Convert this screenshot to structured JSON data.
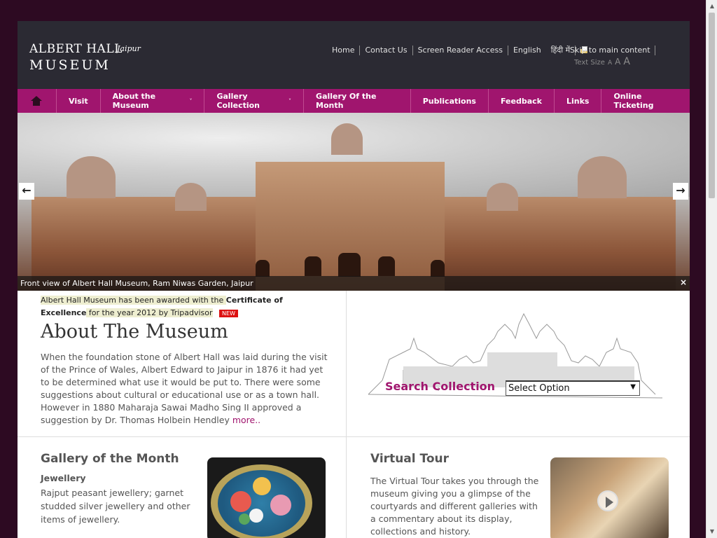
{
  "header": {
    "logo_line1": "ALBERT HALL",
    "logo_jaipur": "Jaipur",
    "logo_line2": "MUSEUM",
    "top_links": [
      "Home",
      "Contact Us",
      "Screen Reader Access",
      "English",
      "हिंदी में"
    ],
    "skip_link": "Skip to main content",
    "text_size_label": "Text Size",
    "text_size_options": [
      "A",
      "A",
      "A"
    ]
  },
  "nav": {
    "items": [
      {
        "label": "Visit"
      },
      {
        "label": "About the Museum",
        "has_dropdown": true
      },
      {
        "label": "Gallery Collection",
        "has_dropdown": true
      },
      {
        "label": "Gallery Of the Month"
      },
      {
        "label": "Publications"
      },
      {
        "label": "Feedback"
      },
      {
        "label": "Links"
      },
      {
        "label": "Online Ticketing"
      }
    ],
    "chevron": "˅"
  },
  "hero": {
    "caption": "Front view of Albert Hall Museum, Ram Niwas Garden, Jaipur",
    "prev_arrow": "←",
    "next_arrow": "→",
    "close": "×"
  },
  "about": {
    "award_pre": "Albert Hall Museum has been awarded with the ",
    "award_bold": "Certificate of Excellence",
    "award_post": " for the year 2012 by Tripadvisor",
    "new_badge": "NEW",
    "title": "About The Museum",
    "text": "When the foundation stone of Albert Hall was laid during the visit of the Prince of Wales, Albert Edward to Jaipur in 1876 it had yet to be determined what use it would be put to. There were some suggestions about cultural or educational use or as a town hall. However in 1880 Maharaja Sawai Madho Sing II approved a suggestion by Dr. Thomas Holbein Hendley ",
    "more_link": "more.."
  },
  "search": {
    "label": "Search Collection",
    "select_value": "Select Option",
    "select_arrow": "▼"
  },
  "gallery": {
    "title": "Gallery of the Month",
    "subtitle": "Jewellery",
    "text": "Rajput peasant jewellery; garnet studded silver jewellery and other items of jewellery."
  },
  "virtual_tour": {
    "title": "Virtual Tour",
    "text": "The Virtual Tour takes you through the museum giving you a glimpse of the courtyards and different galleries with a commentary about its display, collections and history."
  },
  "colors": {
    "brand_magenta": "#a0156e",
    "header_dark": "#2b2a33",
    "page_bg": "#2d0a22"
  },
  "scrollbar": {
    "up": "▲",
    "down": "▼"
  }
}
